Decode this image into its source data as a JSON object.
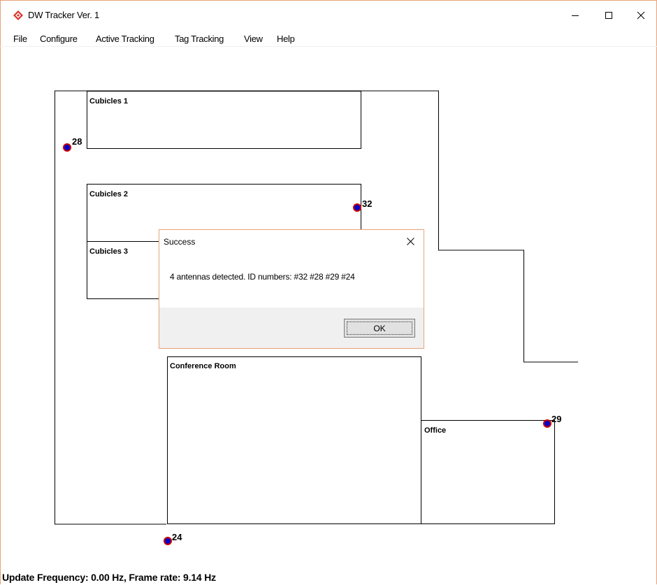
{
  "window": {
    "title": "DW Tracker Ver. 1",
    "icon": "red-diamond-icon",
    "controls": [
      "minimize",
      "maximize",
      "close"
    ]
  },
  "menu": [
    {
      "label": "File"
    },
    {
      "label": "Configure"
    },
    {
      "label": "Active Tracking"
    },
    {
      "label": "Tag Tracking"
    },
    {
      "label": "View"
    },
    {
      "label": "Help"
    }
  ],
  "map": {
    "rooms": [
      {
        "label": "Cubicles 1"
      },
      {
        "label": "Cubicles 2"
      },
      {
        "label": "Cubicles 3"
      },
      {
        "label": "Conference Room"
      },
      {
        "label": "Office"
      }
    ],
    "antennas": [
      {
        "id": "28"
      },
      {
        "id": "32"
      },
      {
        "id": "29"
      },
      {
        "id": "24"
      }
    ],
    "colors": {
      "line": "#000000",
      "antenna_fill": "#0000cc",
      "antenna_outline": "#cc0000"
    }
  },
  "dialog": {
    "title": "Success",
    "message": "4 antennas detected. ID numbers: #32 #28 #29 #24",
    "ok_label": "OK"
  },
  "status": {
    "text": "Update Frequency: 0.00 Hz, Frame rate: 9.14 Hz"
  }
}
